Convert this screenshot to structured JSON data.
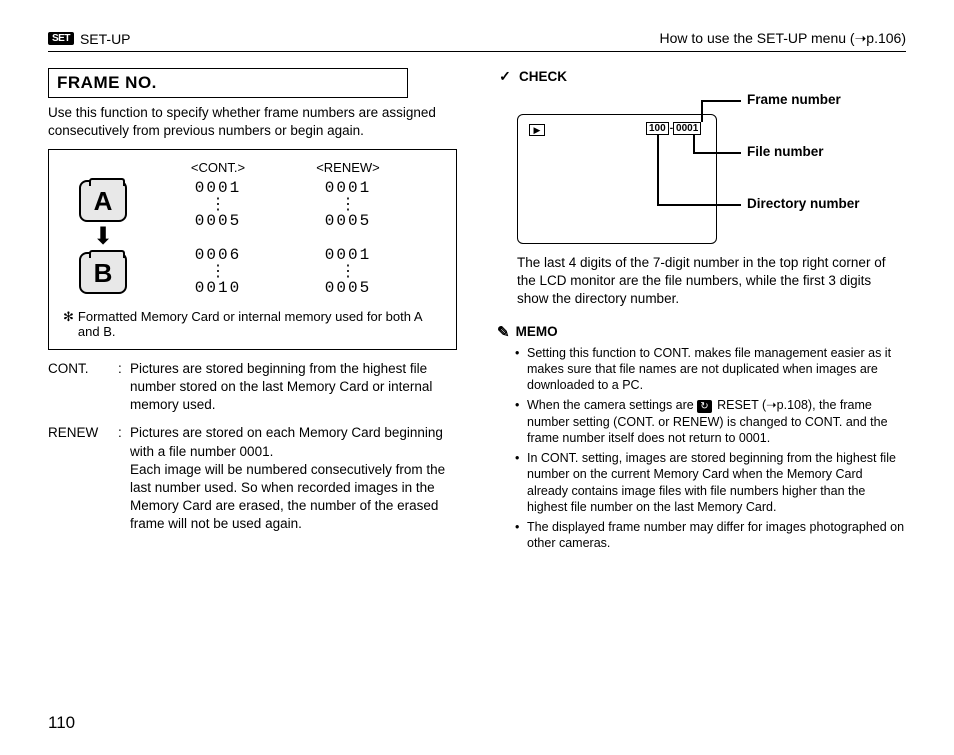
{
  "header": {
    "set_label": "SET",
    "setup_label": "SET-UP",
    "right_text": "How to use the SET-UP menu (➝p.106)"
  },
  "left": {
    "title": "FRAME NO.",
    "intro": "Use this function to specify whether frame numbers are assigned consecutively from previous numbers or begin again.",
    "cont_label": "<CONT.>",
    "renew_label": "<RENEW>",
    "card_a": "A",
    "card_b": "B",
    "nums": {
      "cont": {
        "a_start": "0001",
        "a_end": "0005",
        "b_start": "0006",
        "b_end": "0010"
      },
      "renew": {
        "a_start": "0001",
        "a_end": "0005",
        "b_start": "0001",
        "b_end": "0005"
      }
    },
    "footnote_star": "✻",
    "footnote": "Formatted Memory Card or internal memory used for both A and B.",
    "defs": [
      {
        "term": "CONT.",
        "body": "Pictures are stored beginning from the highest file number stored on the last Memory Card or internal memory used."
      },
      {
        "term": "RENEW",
        "body": "Pictures are stored on each Memory Card beginning with a file number 0001.\nEach image will be numbered consecutively from the last number used. So when recorded images in the Memory Card are erased, the number of the erased frame will not be used again."
      }
    ]
  },
  "right": {
    "check_label": "CHECK",
    "lcd": {
      "dir": "100",
      "file": "0001",
      "sep": "-"
    },
    "callouts": {
      "frame": "Frame number",
      "file": "File number",
      "dir": "Directory number"
    },
    "desc": "The last 4 digits of the 7-digit number in the top right corner of the LCD monitor are the file numbers, while the first 3 digits show the directory number.",
    "memo_label": "MEMO",
    "reset_icon_text": "↻",
    "memo_items": [
      "Setting this function to CONT. makes file management easier as it makes sure that file names are not duplicated when images are downloaded to a PC.",
      "When the camera settings are  RESET (➝p.108), the frame number setting (CONT. or RENEW) is changed to CONT. and the frame number itself does not return to 0001.",
      "In CONT. setting, images are stored beginning from the highest file number on the current Memory Card when the Memory Card already contains image files with file numbers higher than the highest file number on the last Memory Card.",
      "The displayed frame number may differ for images photographed on other cameras."
    ]
  },
  "page_number": "110"
}
